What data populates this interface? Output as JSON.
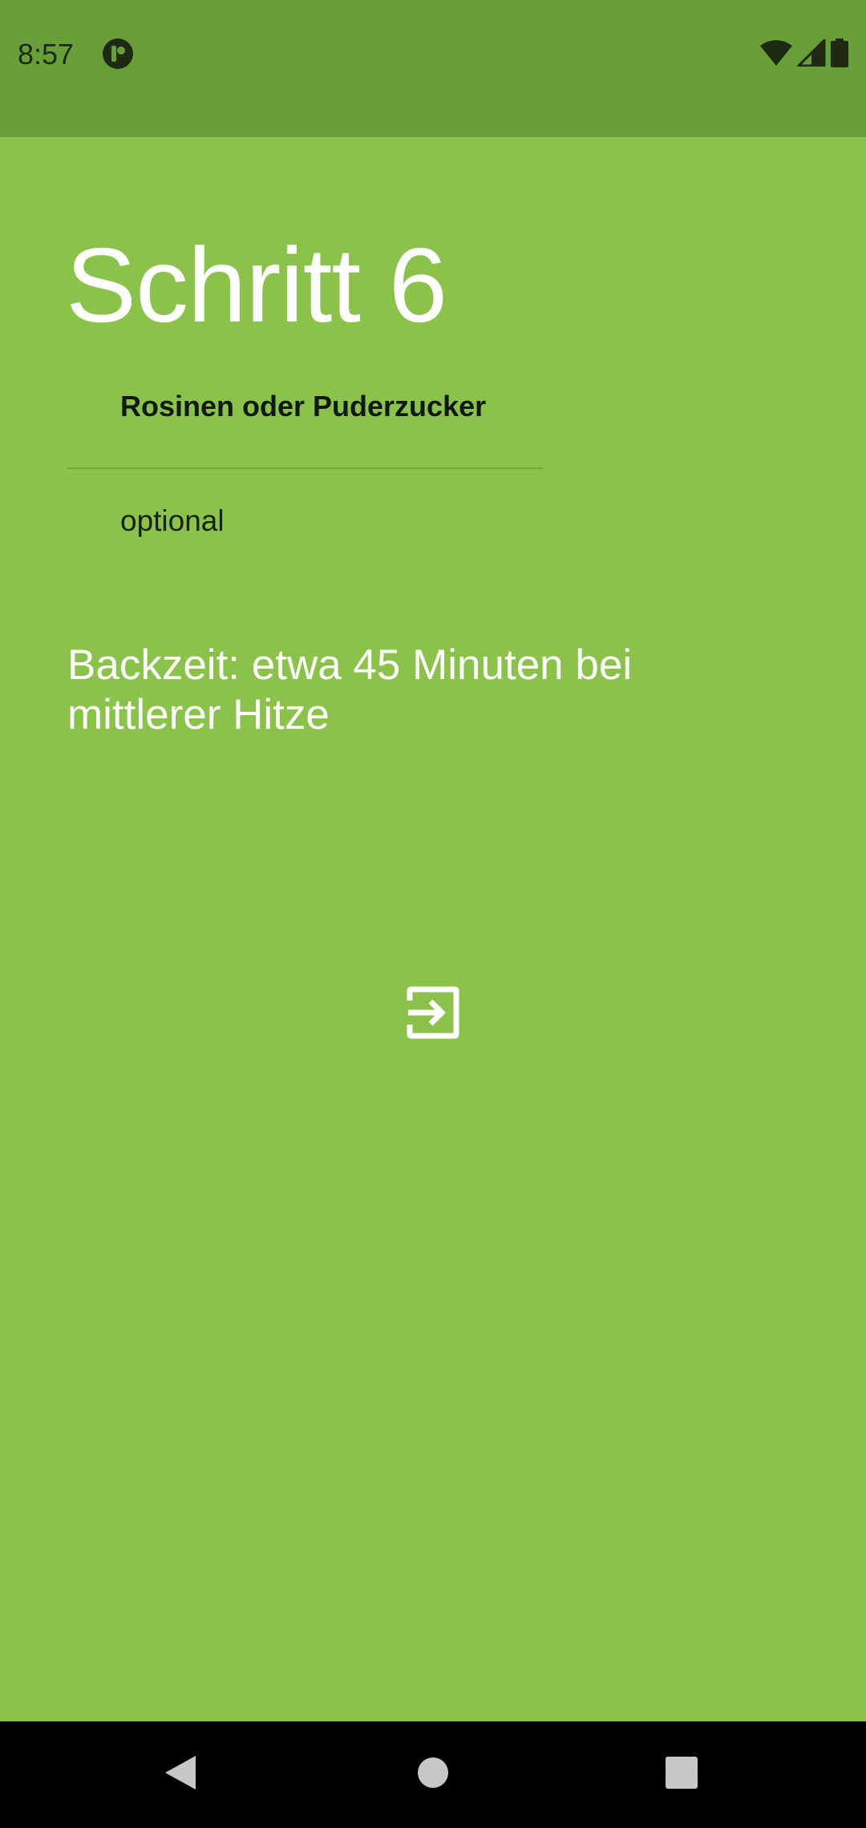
{
  "status_bar": {
    "time": "8:57",
    "app_icon": "notification-app-icon",
    "wifi_icon": "wifi-icon",
    "signal_icon": "signal-icon",
    "battery_icon": "battery-icon"
  },
  "step": {
    "title": "Schritt 6",
    "ingredient": "Rosinen oder Puderzucker",
    "note": "optional",
    "instruction": "Backzeit: etwa 45 Minuten bei mittlerer Hitze"
  },
  "next_button": {
    "icon": "exit-to-app-icon"
  },
  "nav_bar": {
    "back_icon": "back-triangle-icon",
    "home_icon": "home-circle-icon",
    "recents_icon": "recents-square-icon"
  },
  "colors": {
    "status_bar": "#689f38",
    "background": "#8bc34a",
    "text_light": "#ffffff",
    "text_dark": "#111711"
  }
}
